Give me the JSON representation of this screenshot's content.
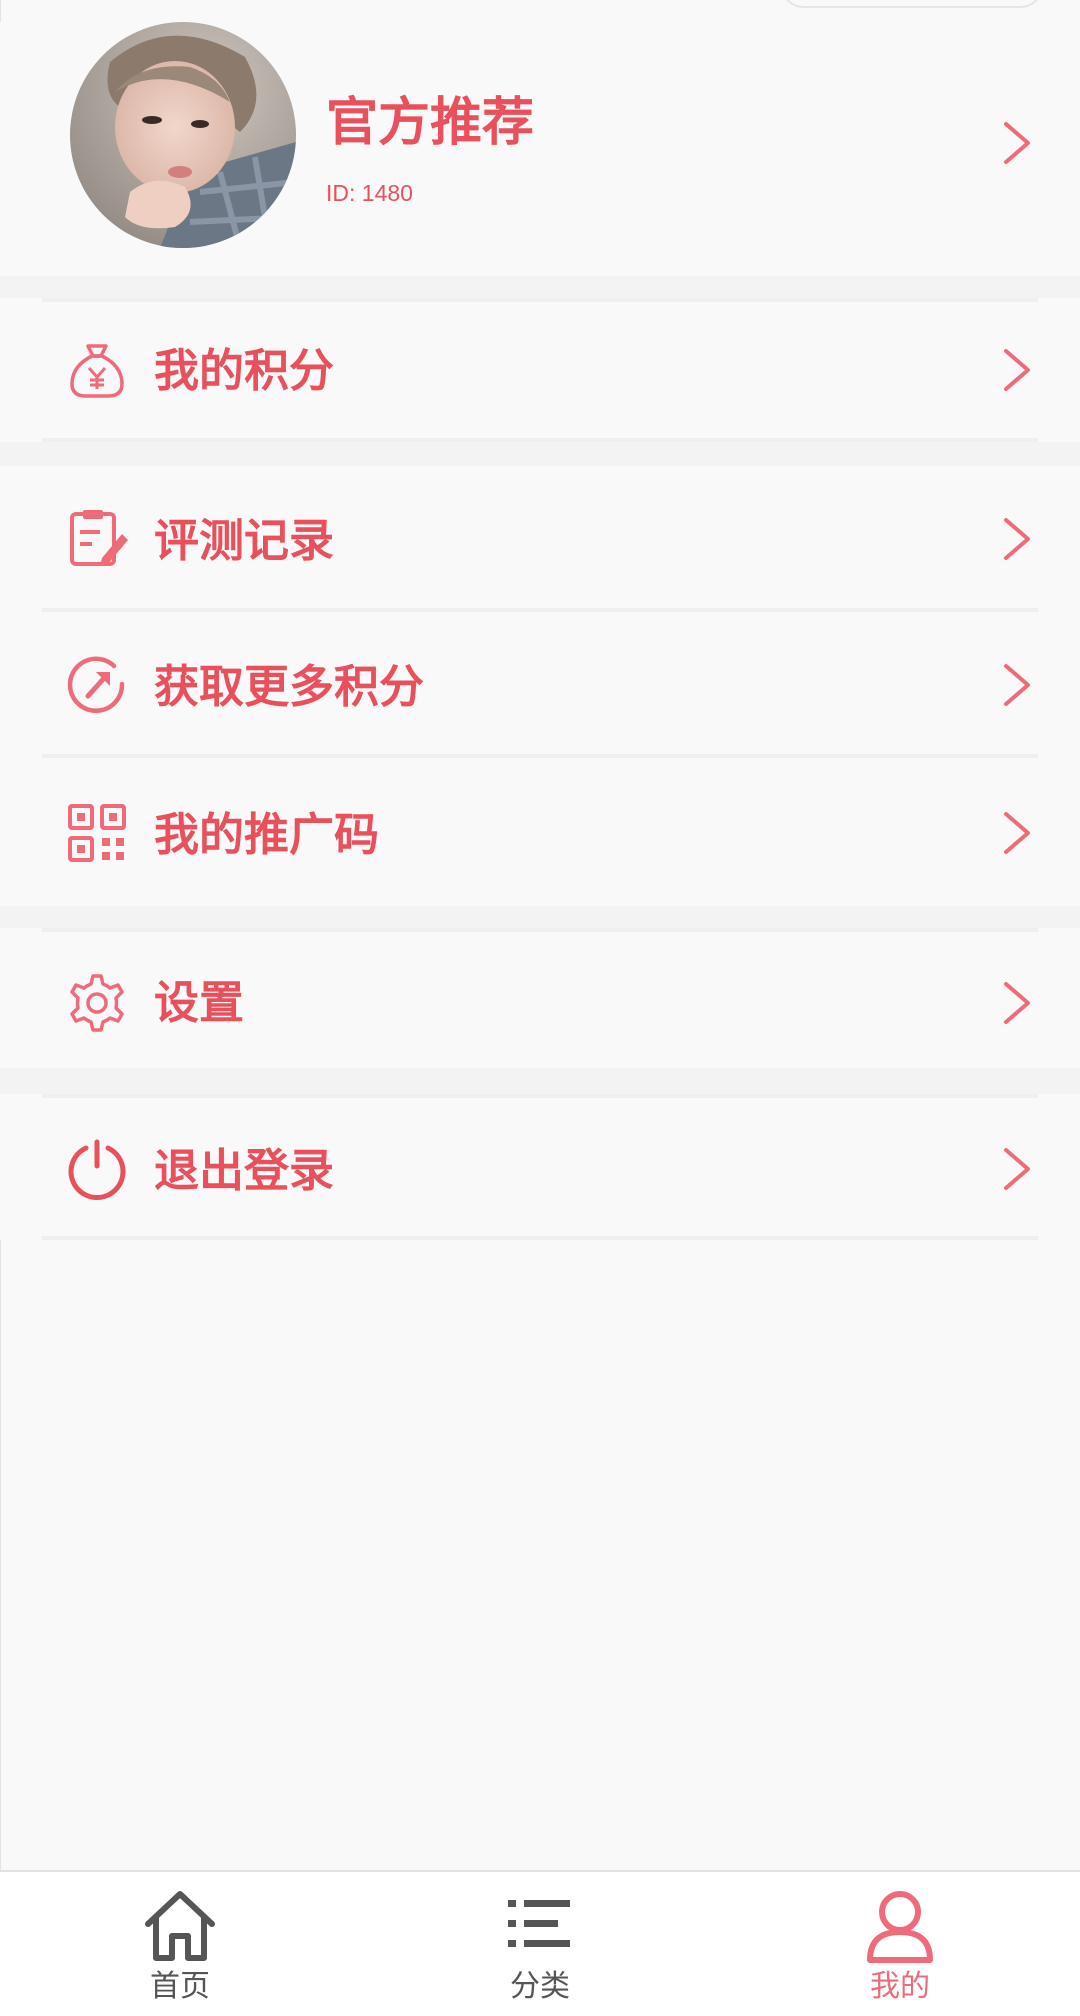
{
  "colors": {
    "accent": "#e8505b",
    "icon_pink": "#ef6b79",
    "tab_inactive": "#555555",
    "background": "#f9f9f9",
    "tab_bar_bg": "#ffffff"
  },
  "profile": {
    "name": "官方推荐",
    "id_text": "ID: 1480"
  },
  "menu": {
    "points": {
      "label": "我的积分",
      "icon": "money-bag-icon"
    },
    "records": {
      "label": "评测记录",
      "icon": "clipboard-edit-icon"
    },
    "more_points": {
      "label": "获取更多积分",
      "icon": "compass-arrow-icon"
    },
    "promo_code": {
      "label": "我的推广码",
      "icon": "qr-code-icon"
    },
    "settings": {
      "label": "设置",
      "icon": "gear-icon"
    },
    "logout": {
      "label": "退出登录",
      "icon": "power-icon"
    }
  },
  "tabbar": {
    "home": {
      "label": "首页",
      "icon": "home-icon"
    },
    "category": {
      "label": "分类",
      "icon": "list-icon"
    },
    "mine": {
      "label": "我的",
      "icon": "user-icon",
      "active": true
    }
  }
}
